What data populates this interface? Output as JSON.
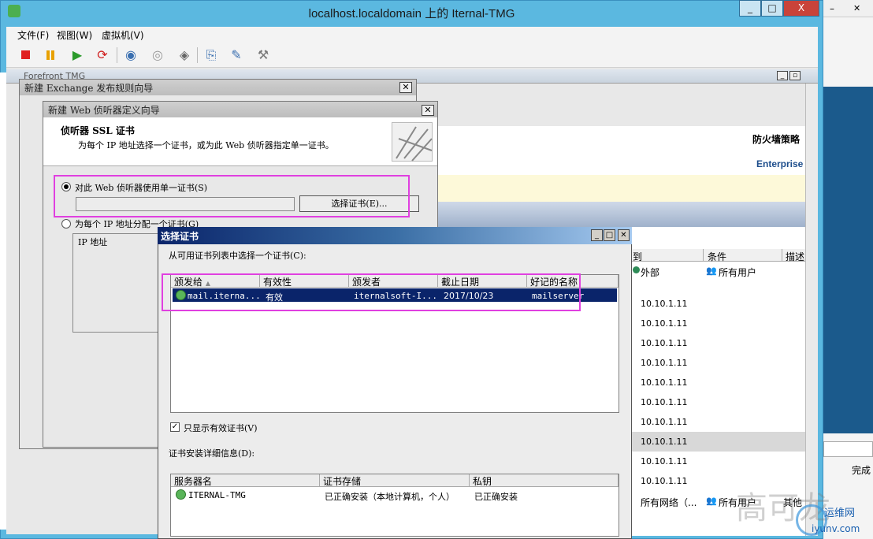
{
  "vm": {
    "title": "localhost.localdomain 上的 Iternal-TMG",
    "caption_minimize": "_",
    "caption_maximize": "□",
    "caption_close": "X",
    "menu": [
      "文件(F)",
      "视图(W)",
      "虚拟机(V)"
    ]
  },
  "toolbar_icons": [
    "stop-icon",
    "pause-icon",
    "play-icon",
    "reset-icon",
    "snapshot-icon",
    "revert-icon",
    "manage-snapshots-icon",
    "send-keys-icon",
    "settings-icon",
    "tools-icon"
  ],
  "tmg": {
    "title": "Forefront TMG",
    "policy_heading": "防火墙策略",
    "edition": "Enterprise",
    "grid_headers": [
      "到",
      "条件",
      "描述"
    ],
    "first_row": {
      "to": "外部",
      "condition": "所有用户"
    },
    "ip_rows": [
      "10.10.1.11",
      "10.10.1.11",
      "10.10.1.11",
      "10.10.1.11",
      "10.10.1.11",
      "10.10.1.11",
      "10.10.1.11",
      "10.10.1.11",
      "10.10.1.11",
      "10.10.1.11"
    ],
    "last_row": {
      "to": "所有网络（...",
      "condition": "所有用户",
      "desc": "其他"
    }
  },
  "right_strip": {
    "finish": "完成"
  },
  "exchange_wizard": {
    "title": "新建 Exchange 发布规则向导"
  },
  "web_wizard": {
    "title": "新建 Web 侦听器定义向导",
    "heading": "侦听器 SSL 证书",
    "subheading": "为每个 IP 地址选择一个证书，或为此 Web 侦听器指定单一证书。",
    "radio_single": "对此 Web 侦听器使用单一证书(S)",
    "select_cert_button": "选择证书(E)...",
    "radio_per_ip": "为每个 IP 地址分配一个证书(G)",
    "ip_column": "IP 地址"
  },
  "cert_dialog": {
    "title": "选择证书",
    "instruction": "从可用证书列表中选择一个证书(C):",
    "columns": [
      "颁发给",
      "有效性",
      "颁发者",
      "截止日期",
      "好记的名称"
    ],
    "rows": [
      {
        "issued_to": "mail.iterna...",
        "validity": "有效",
        "issuer": "iternalsoft-I...",
        "expiry": "2017/10/23",
        "friendly": "mailserver"
      }
    ],
    "only_valid_label": "只显示有效证书(V)",
    "details_label": "证书安装详细信息(D):",
    "detail_columns": [
      "服务器名",
      "证书存储",
      "私钥"
    ],
    "detail_rows": [
      {
        "server": "ITERNAL-TMG",
        "store": "已正确安装（本地计算机，个人）",
        "key": "已正确安装"
      }
    ]
  },
  "watermark": {
    "text": "高可龙",
    "site_name": "运维网",
    "site_url": "iyunv.com"
  }
}
